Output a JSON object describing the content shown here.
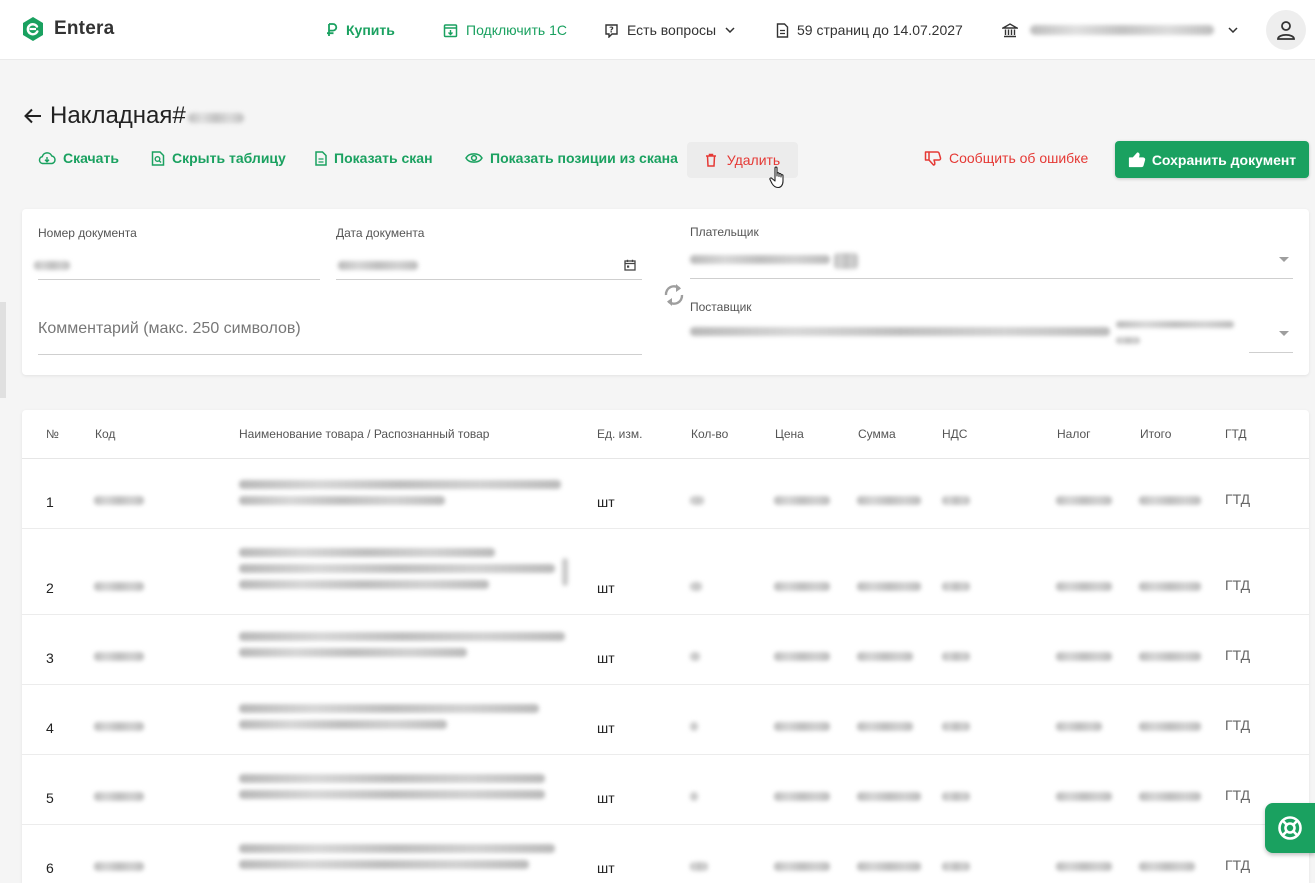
{
  "app": {
    "brand": "Entera"
  },
  "header": {
    "buy": "Купить",
    "connect_1c": "Подключить 1С",
    "questions": "Есть вопросы",
    "pages_info": "59 страниц до 14.07.2027"
  },
  "document": {
    "title": "Накладная#"
  },
  "toolbar": {
    "download": "Скачать",
    "hide_table": "Скрыть таблицу",
    "show_scan": "Показать скан",
    "show_positions": "Показать позиции из скана",
    "delete": "Удалить",
    "report_error": "Сообщить об ошибке",
    "save": "Сохранить документ"
  },
  "form": {
    "doc_number_label": "Номер документа",
    "doc_date_label": "Дата документа",
    "payer_label": "Плательщик",
    "supplier_label": "Поставщик",
    "comment_placeholder": "Комментарий (макс. 250 символов)"
  },
  "table": {
    "columns": [
      "№",
      "Код",
      "Наименование товара / Распознанный товар",
      "Ед. изм.",
      "Кол-во",
      "Цена",
      "Сумма",
      "НДС",
      "Налог",
      "Итого",
      "ГТД"
    ],
    "rows": [
      {
        "num": "1",
        "unit": "шт",
        "gtd": "ГТД"
      },
      {
        "num": "2",
        "unit": "шт",
        "gtd": "ГТД"
      },
      {
        "num": "3",
        "unit": "шт",
        "gtd": "ГТД"
      },
      {
        "num": "4",
        "unit": "шт",
        "gtd": "ГТД"
      },
      {
        "num": "5",
        "unit": "шт",
        "gtd": "ГТД"
      },
      {
        "num": "6",
        "unit": "шт",
        "gtd": "ГТД"
      }
    ]
  },
  "colors": {
    "accent": "#1aa160",
    "danger": "#e53935"
  }
}
